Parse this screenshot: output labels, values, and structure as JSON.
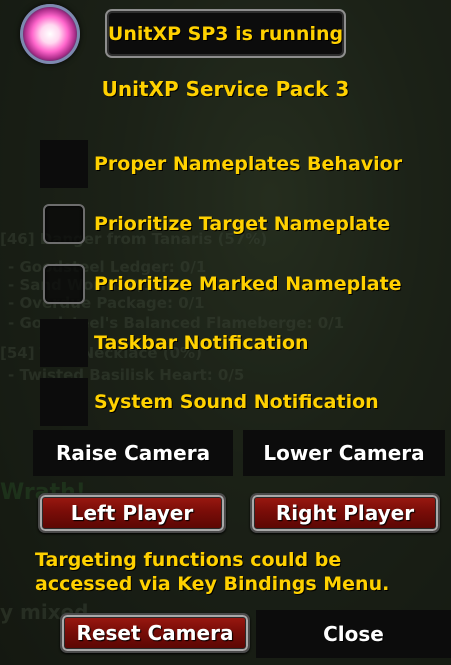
{
  "header": {
    "status_text": "UnitXP SP3 is running",
    "title": "UnitXP Service Pack 3"
  },
  "options": [
    {
      "label": "Proper Nameplates Behavior",
      "checked": false
    },
    {
      "label": "Prioritize Target Nameplate",
      "checked": false
    },
    {
      "label": "Prioritize Marked Nameplate",
      "checked": false
    },
    {
      "label": "Taskbar Notification",
      "checked": false
    },
    {
      "label": "System Sound Notification",
      "checked": false
    }
  ],
  "camera": {
    "raise_label": "Raise Camera",
    "lower_label": "Lower Camera"
  },
  "player": {
    "left_label": "Left Player",
    "right_label": "Right Player"
  },
  "info_text": "Targeting functions could be accessed via Key Bindings Menu.",
  "footer": {
    "reset_label": "Reset Camera",
    "close_label": "Close"
  },
  "colors": {
    "accent_gold": "#ffd100",
    "button_red": "#7a0d08",
    "panel_black": "#0c0c0c"
  }
}
